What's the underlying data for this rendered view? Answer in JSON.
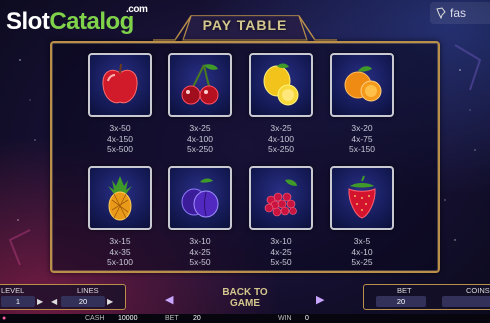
{
  "logo": {
    "slot": "Slot",
    "catalog": "Catalog",
    "com": ".com"
  },
  "top_right_logo": {
    "text": "fas",
    "icon": "bird-logo-icon"
  },
  "title": "PAY TABLE",
  "symbols": [
    {
      "name": "apple",
      "pays": [
        "3x-50",
        "4x-150",
        "5x-500"
      ]
    },
    {
      "name": "cherries",
      "pays": [
        "3x-25",
        "4x-100",
        "5x-250"
      ]
    },
    {
      "name": "lemon",
      "pays": [
        "3x-25",
        "4x-100",
        "5x-250"
      ]
    },
    {
      "name": "orange",
      "pays": [
        "3x-20",
        "4x-75",
        "5x-150"
      ]
    },
    {
      "name": "pineapple",
      "pays": [
        "3x-15",
        "4x-35",
        "5x-100"
      ]
    },
    {
      "name": "plum",
      "pays": [
        "3x-10",
        "4x-25",
        "5x-50"
      ]
    },
    {
      "name": "raspberry",
      "pays": [
        "3x-10",
        "4x-25",
        "5x-50"
      ]
    },
    {
      "name": "strawberry",
      "pays": [
        "3x-5",
        "4x-10",
        "5x-25"
      ]
    }
  ],
  "controls": {
    "level_label": "LEVEL",
    "level_value": "1",
    "lines_label": "LINES",
    "lines_value": "20",
    "back_line1": "BACK TO",
    "back_line2": "GAME",
    "bet_label": "BET",
    "bet_value": "20",
    "coins_label": "COINS"
  },
  "status": {
    "cash_label": "CASH",
    "cash_value": "10000",
    "bet_label": "BET",
    "bet_value": "20",
    "win_label": "WIN",
    "win_value": "0"
  },
  "colors": {
    "gold": "#b98f4a",
    "title_text": "#d4c78d",
    "tile_bg": "#1a2070",
    "logo_green": "#7fd24a"
  }
}
